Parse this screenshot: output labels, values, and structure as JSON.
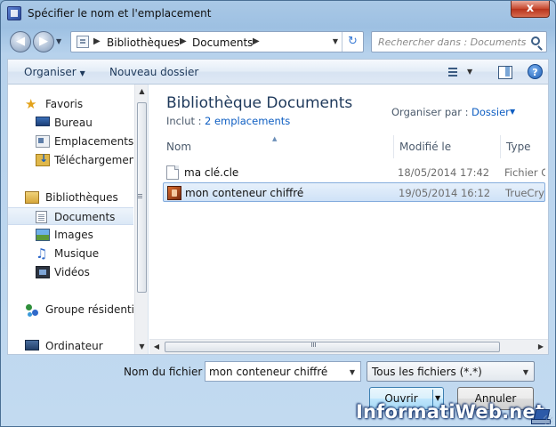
{
  "window": {
    "title": "Spécifier le nom et l'emplacement",
    "close_glyph": "x"
  },
  "address": {
    "crumbs": [
      "Bibliothèques",
      "Documents"
    ],
    "search_placeholder": "Rechercher dans : Documents"
  },
  "toolbar": {
    "organize_label": "Organiser",
    "new_folder_label": "Nouveau dossier",
    "help_glyph": "?"
  },
  "sidebar": {
    "items": [
      {
        "label": "Favoris",
        "icon": "star-icon"
      },
      {
        "label": "Bureau",
        "icon": "desktop-icon"
      },
      {
        "label": "Emplacements ré",
        "icon": "recent-places-icon"
      },
      {
        "label": "Téléchargements",
        "icon": "downloads-icon"
      },
      {
        "label": "Bibliothèques",
        "icon": "libraries-icon"
      },
      {
        "label": "Documents",
        "icon": "documents-icon",
        "selected": true
      },
      {
        "label": "Images",
        "icon": "pictures-icon"
      },
      {
        "label": "Musique",
        "icon": "music-icon"
      },
      {
        "label": "Vidéos",
        "icon": "videos-icon"
      },
      {
        "label": "Groupe résidentiel",
        "icon": "homegroup-icon"
      },
      {
        "label": "Ordinateur",
        "icon": "computer-icon"
      }
    ]
  },
  "library": {
    "title": "Bibliothèque Documents",
    "include_label": "Inclut :",
    "include_link": "2 emplacements",
    "arrange_label": "Organiser par :",
    "arrange_value": "Dossier"
  },
  "columns": [
    "Nom",
    "Modifié le",
    "Type"
  ],
  "files": [
    {
      "name": "ma clé.cle",
      "modified": "18/05/2014 17:42",
      "type": "Fichier CL",
      "icon": "blank-file-icon"
    },
    {
      "name": "mon conteneur chiffré",
      "modified": "19/05/2014 16:12",
      "type": "TrueCrypt",
      "icon": "truecrypt-file-icon",
      "selected": true
    }
  ],
  "footer": {
    "filename_label": "Nom du fichier :",
    "filename_value": "mon conteneur chiffré",
    "filetype_value": "Tous les fichiers (*.*)",
    "open_label": "Ouvrir",
    "cancel_label": "Annuler"
  },
  "watermark": "InformatiWeb.net",
  "colors": {
    "accent_link": "#0e5ec2",
    "title_text": "#1e395b",
    "selection": "#cfe2f7"
  }
}
